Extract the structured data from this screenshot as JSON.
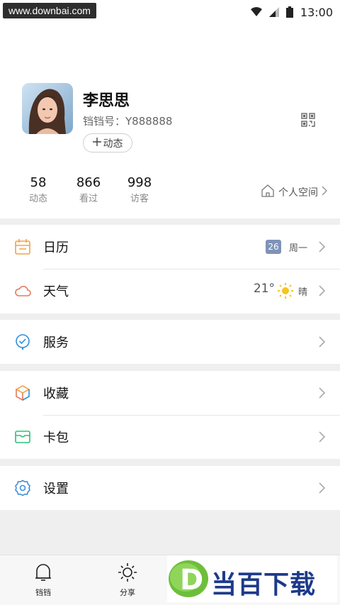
{
  "watermark": "www.downbai.com",
  "status": {
    "time": "13:00"
  },
  "profile": {
    "name": "李思思",
    "account": "铛铛号：Y888888",
    "dynamic_button": "动态",
    "stats": [
      {
        "value": "58",
        "label": "动态"
      },
      {
        "value": "866",
        "label": "看过"
      },
      {
        "value": "998",
        "label": "访客"
      }
    ],
    "space_link": "个人空间"
  },
  "menu": {
    "calendar": {
      "label": "日历",
      "date": "26",
      "weekday": "周一"
    },
    "weather": {
      "label": "天气",
      "temp": "21°",
      "condition": "晴"
    },
    "service": {
      "label": "服务"
    },
    "favorites": {
      "label": "收藏"
    },
    "card": {
      "label": "卡包"
    },
    "settings": {
      "label": "设置"
    }
  },
  "tabbar": {
    "items": [
      {
        "label": "铛铛",
        "icon": "bell-icon"
      },
      {
        "label": "分享",
        "icon": "sun-icon"
      }
    ]
  },
  "overlay_logo": {
    "text": "当百下载",
    "letter": "D"
  },
  "colors": {
    "calendar_icon": "#f0a34a",
    "weather_icon": "#e57a5d",
    "service_icon": "#2d8fe0",
    "card_icon": "#2cc07a",
    "settings_icon": "#3d8fd8",
    "date_badge": "#7f93b8",
    "logo_green": "#6dbf3a",
    "logo_blue": "#1d3a8a"
  }
}
